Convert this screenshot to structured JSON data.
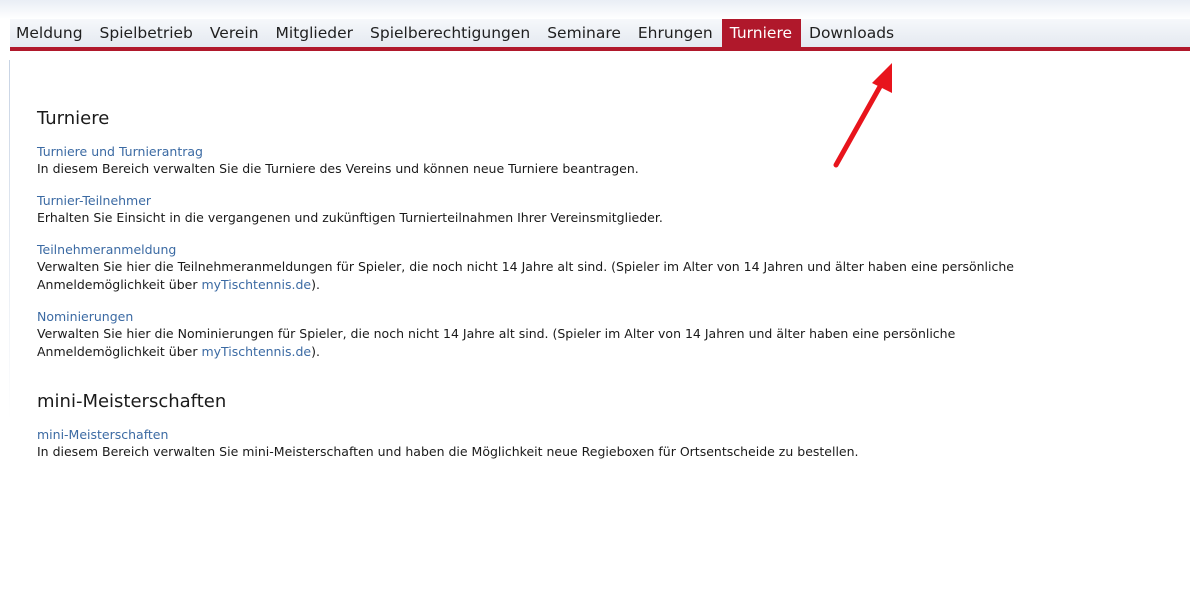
{
  "nav": {
    "items": [
      {
        "label": "Meldung",
        "active": false
      },
      {
        "label": "Spielbetrieb",
        "active": false
      },
      {
        "label": "Verein",
        "active": false
      },
      {
        "label": "Mitglieder",
        "active": false
      },
      {
        "label": "Spielberechtigungen",
        "active": false
      },
      {
        "label": "Seminare",
        "active": false
      },
      {
        "label": "Ehrungen",
        "active": false
      },
      {
        "label": "Turniere",
        "active": true
      },
      {
        "label": "Downloads",
        "active": false
      }
    ]
  },
  "colors": {
    "accent": "#b0182b",
    "link": "#3b6aa3",
    "arrow": "#e8141c"
  },
  "sections": [
    {
      "title": "Turniere",
      "entries": [
        {
          "link": "Turniere und Turnierantrag",
          "desc": "In diesem Bereich verwalten Sie die Turniere des Vereins und können neue Turniere beantragen."
        },
        {
          "link": "Turnier-Teilnehmer",
          "desc": "Erhalten Sie Einsicht in die vergangenen und zukünftigen Turnierteilnahmen Ihrer Vereinsmitglieder."
        },
        {
          "link": "Teilnehmeranmeldung",
          "desc_line1": "Verwalten Sie hier die Teilnehmeranmeldungen für Spieler, die noch nicht 14 Jahre alt sind. (Spieler im Alter von 14 Jahren und älter haben eine persönliche",
          "desc_line2_prefix": "Anmeldemöglichkeit über ",
          "desc_line2_link": "myTischtennis.de",
          "desc_line2_suffix": ")."
        },
        {
          "link": "Nominierungen",
          "desc_line1": "Verwalten Sie hier die Nominierungen für Spieler, die noch nicht 14 Jahre alt sind. (Spieler im Alter von 14 Jahren und älter haben eine persönliche",
          "desc_line2_prefix": "Anmeldemöglichkeit über ",
          "desc_line2_link": "myTischtennis.de",
          "desc_line2_suffix": ")."
        }
      ]
    },
    {
      "title": "mini-Meisterschaften",
      "entries": [
        {
          "link": "mini-Meisterschaften",
          "desc": "In diesem Bereich verwalten Sie mini-Meisterschaften und haben die Möglichkeit neue Regieboxen für Ortsentscheide zu bestellen."
        }
      ]
    }
  ]
}
